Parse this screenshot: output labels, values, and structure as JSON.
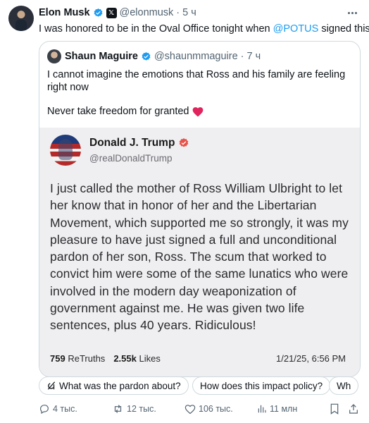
{
  "tweet": {
    "author_name": "Elon Musk",
    "author_handle": "@elonmusk",
    "separator": "·",
    "time": "5 ч",
    "text_before": "I was honored to be in the Oval Office tonight when ",
    "mention": "@POTUS",
    "text_after": " signed this"
  },
  "quote": {
    "author_name": "Shaun Maguire",
    "author_handle": "@shaunmmaguire",
    "separator": "·",
    "time": "7 ч",
    "text_line1": "I cannot imagine the emotions that Ross and his family are feeling right now",
    "text_line2": "Never take freedom for granted",
    "emoji": "❤️"
  },
  "truth_card": {
    "name": "Donald J. Trump",
    "handle": "@realDonaldTrump",
    "body": "I just called the mother of Ross William Ulbright to let her know that in honor of her and the Libertarian Movement, which supported me so strongly, it was my pleasure to have just signed a full and unconditional pardon of her son, Ross. The scum that worked to convict him were some of the same lunatics who were involved in the modern day weaponization of government against me. He was given two life sentences, plus 40 years. Ridiculous!",
    "retruths_count": "759",
    "retruths_label": "ReTruths",
    "likes_count": "2.55k",
    "likes_label": "Likes",
    "date": "1/21/25, 6:56 PM"
  },
  "grok_suggestions": [
    "What was the pardon about?",
    "How does this impact policy?",
    "Wh"
  ],
  "actions": {
    "replies": "4 тыс.",
    "reposts": "12 тыс.",
    "likes": "106 тыс.",
    "views": "11 млн"
  },
  "colors": {
    "accent": "#1d9bf0",
    "verified_blue": "#1d9bf0",
    "truth_verified": "#e8524a",
    "heart": "#e0245e",
    "secondary_text": "#536471",
    "border": "#cfd9de",
    "card_bg": "#efeff1"
  },
  "icons": [
    "verified-badge-icon",
    "x-affiliate-icon",
    "more-icon",
    "heart-emoji-icon",
    "grok-icon",
    "reply-icon",
    "repost-icon",
    "like-icon",
    "views-icon",
    "bookmark-icon",
    "share-icon"
  ]
}
